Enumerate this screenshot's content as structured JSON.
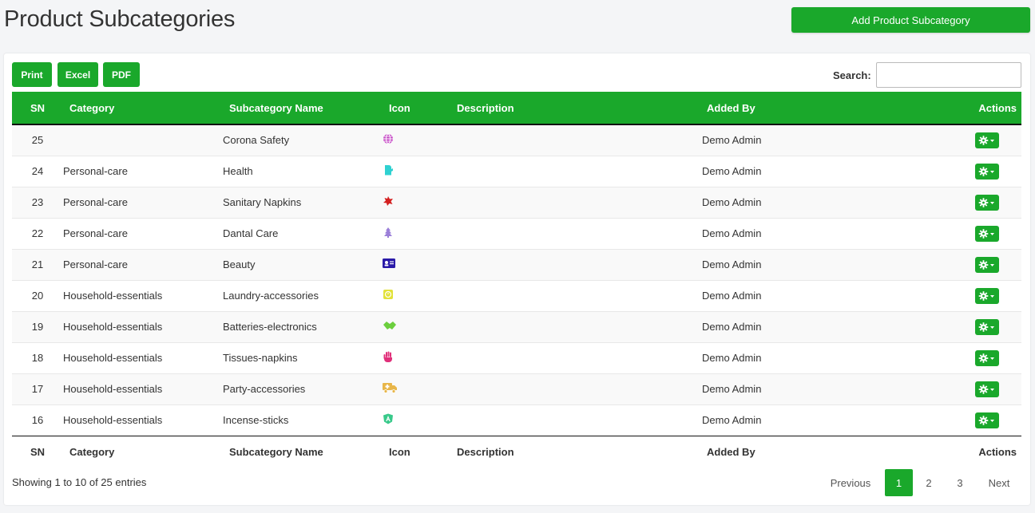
{
  "page": {
    "title": "Product Subcategories",
    "add_button": "Add Product Subcategory"
  },
  "toolbar": {
    "print": "Print",
    "excel": "Excel",
    "pdf": "PDF",
    "search_label": "Search:",
    "search_value": ""
  },
  "table": {
    "headers": {
      "sn": "SN",
      "category": "Category",
      "subcategory": "Subcategory Name",
      "icon": "Icon",
      "description": "Description",
      "added_by": "Added By",
      "actions": "Actions"
    },
    "rows": [
      {
        "sn": "25",
        "category": "",
        "subcategory": "Corona Safety",
        "icon": "globe-icon",
        "icon_color": "#c548c5",
        "description": "",
        "added_by": "Demo Admin"
      },
      {
        "sn": "24",
        "category": "Personal-care",
        "subcategory": "Health",
        "icon": "mitten-icon",
        "icon_color": "#2fd1d1",
        "description": "",
        "added_by": "Demo Admin"
      },
      {
        "sn": "23",
        "category": "Personal-care",
        "subcategory": "Sanitary Napkins",
        "icon": "starburst-icon",
        "icon_color": "#d42020",
        "description": "",
        "added_by": "Demo Admin"
      },
      {
        "sn": "22",
        "category": "Personal-care",
        "subcategory": "Dantal Care",
        "icon": "tree-icon",
        "icon_color": "#9b7fd8",
        "description": "",
        "added_by": "Demo Admin"
      },
      {
        "sn": "21",
        "category": "Personal-care",
        "subcategory": "Beauty",
        "icon": "id-card-icon",
        "icon_color": "#2a1aa8",
        "description": "",
        "added_by": "Demo Admin"
      },
      {
        "sn": "20",
        "category": "Household-essentials",
        "subcategory": "Laundry-accessories",
        "icon": "clock-icon",
        "icon_color": "#e2e23a",
        "description": "",
        "added_by": "Demo Admin"
      },
      {
        "sn": "19",
        "category": "Household-essentials",
        "subcategory": "Batteries-electronics",
        "icon": "handshake-icon",
        "icon_color": "#6ccf3e",
        "description": "",
        "added_by": "Demo Admin"
      },
      {
        "sn": "18",
        "category": "Household-essentials",
        "subcategory": "Tissues-napkins",
        "icon": "hand-icon",
        "icon_color": "#e0307a",
        "description": "",
        "added_by": "Demo Admin"
      },
      {
        "sn": "17",
        "category": "Household-essentials",
        "subcategory": "Party-accessories",
        "icon": "ambulance-icon",
        "icon_color": "#e8b64a",
        "description": "",
        "added_by": "Demo Admin"
      },
      {
        "sn": "16",
        "category": "Household-essentials",
        "subcategory": "Incense-sticks",
        "icon": "angular-icon",
        "icon_color": "#38c98a",
        "description": "",
        "added_by": "Demo Admin"
      }
    ]
  },
  "footer": {
    "entries_info": "Showing 1 to 10 of 25 entries",
    "previous": "Previous",
    "pages": [
      "1",
      "2",
      "3"
    ],
    "current_page": "1",
    "next": "Next"
  },
  "colors": {
    "accent": "#1aa82b"
  }
}
